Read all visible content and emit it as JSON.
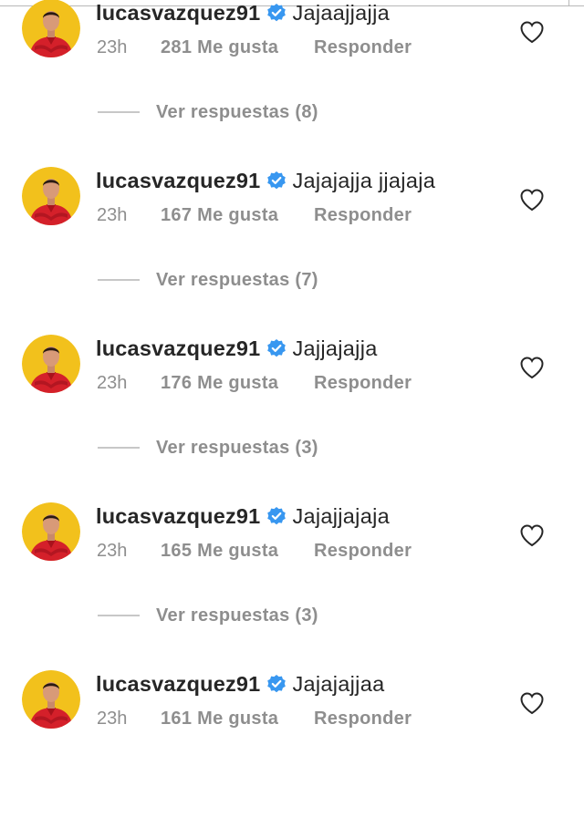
{
  "comments": [
    {
      "username": "lucasvazquez91",
      "text": "Jajaajjajja",
      "time": "23h",
      "likes": "281 Me gusta",
      "reply": "Responder",
      "view_replies": "Ver respuestas (8)"
    },
    {
      "username": "lucasvazquez91",
      "text": "Jajajajja jjajaja",
      "time": "23h",
      "likes": "167 Me gusta",
      "reply": "Responder",
      "view_replies": "Ver respuestas (7)"
    },
    {
      "username": "lucasvazquez91",
      "text": "Jajjajajja",
      "time": "23h",
      "likes": "176 Me gusta",
      "reply": "Responder",
      "view_replies": "Ver respuestas (3)"
    },
    {
      "username": "lucasvazquez91",
      "text": "Jajajjajaja",
      "time": "23h",
      "likes": "165 Me gusta",
      "reply": "Responder",
      "view_replies": "Ver respuestas (3)"
    },
    {
      "username": "lucasvazquez91",
      "text": "Jajajajjaa",
      "time": "23h",
      "likes": "161 Me gusta",
      "reply": "Responder",
      "view_replies": ""
    }
  ],
  "colors": {
    "text": "#262626",
    "secondary": "#8e8e8e",
    "verified_badge": "#3897f0",
    "avatar_background": "#f2c11c",
    "avatar_shirt": "#d4202a"
  },
  "icons": {
    "verified": "verified-badge-icon",
    "like": "heart-outline-icon",
    "avatar": "user-avatar"
  }
}
